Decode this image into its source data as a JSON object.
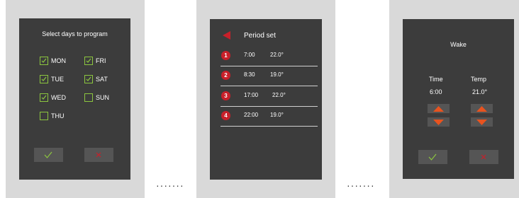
{
  "colors": {
    "screen_bg": "#3c3c3c",
    "bezel": "#d9d9d9",
    "check_green": "#8cc63f",
    "cancel_red": "#c8202a",
    "arrow_orange": "#e8531f",
    "button_bg": "#555555"
  },
  "separator": "·······",
  "select_days": {
    "title": "Select days to program",
    "days": [
      {
        "label": "MON",
        "checked": true
      },
      {
        "label": "FRI",
        "checked": true
      },
      {
        "label": "TUE",
        "checked": true
      },
      {
        "label": "SAT",
        "checked": true
      },
      {
        "label": "WED",
        "checked": true
      },
      {
        "label": "SUN",
        "checked": false
      },
      {
        "label": "THU",
        "checked": false
      }
    ],
    "confirm_icon": "checkmark-icon",
    "cancel_icon": "x-icon"
  },
  "period_set": {
    "title": "Period set",
    "back_icon": "back-arrow-icon",
    "periods": [
      {
        "number": "1",
        "time": "7:00",
        "temp": "22.0°"
      },
      {
        "number": "2",
        "time": "8:30",
        "temp": "19.0°"
      },
      {
        "number": "3",
        "time": "17:00",
        "temp": "22.0°"
      },
      {
        "number": "4",
        "time": "22:00",
        "temp": "19.0°"
      }
    ]
  },
  "wake": {
    "title": "Wake",
    "time_label": "Time",
    "temp_label": "Temp",
    "time_value": "6:00",
    "temp_value": "21.0°",
    "up_icon": "arrow-up-icon",
    "down_icon": "arrow-down-icon",
    "confirm_icon": "checkmark-icon",
    "cancel_icon": "x-icon"
  }
}
